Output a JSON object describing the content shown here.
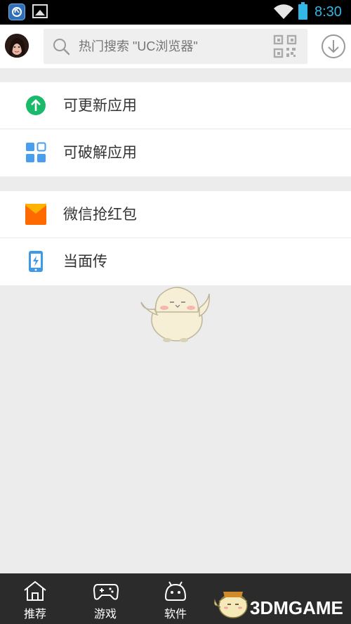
{
  "status_bar": {
    "time": "8:30",
    "accent_color": "#33b5e5",
    "app_icon_letter": "K",
    "icons": [
      "k-app-icon",
      "image-icon",
      "wifi-icon",
      "battery-icon"
    ]
  },
  "header": {
    "search_placeholder": "热门搜索 \"UC浏览器\"",
    "icons": [
      "avatar",
      "search-icon",
      "qr-code-icon",
      "download-icon"
    ]
  },
  "groups": [
    {
      "items": [
        {
          "label": "可更新应用",
          "icon": "upload-arrow-icon",
          "icon_color": "#1aba6b"
        },
        {
          "label": "可破解应用",
          "icon": "grid-apps-icon",
          "icon_color": "#4a9ef0"
        }
      ]
    },
    {
      "items": [
        {
          "label": "微信抢红包",
          "icon": "red-envelope-icon",
          "icon_color": "#ff6a00"
        },
        {
          "label": "当面传",
          "icon": "phone-transfer-icon",
          "icon_color": "#3d9ae8"
        }
      ]
    }
  ],
  "bottom_nav": {
    "tabs": [
      {
        "label": "推荐",
        "icon": "home-icon"
      },
      {
        "label": "游戏",
        "icon": "gamepad-icon"
      },
      {
        "label": "软件",
        "icon": "android-icon"
      }
    ]
  },
  "watermark": {
    "text": "3DMGAME"
  }
}
